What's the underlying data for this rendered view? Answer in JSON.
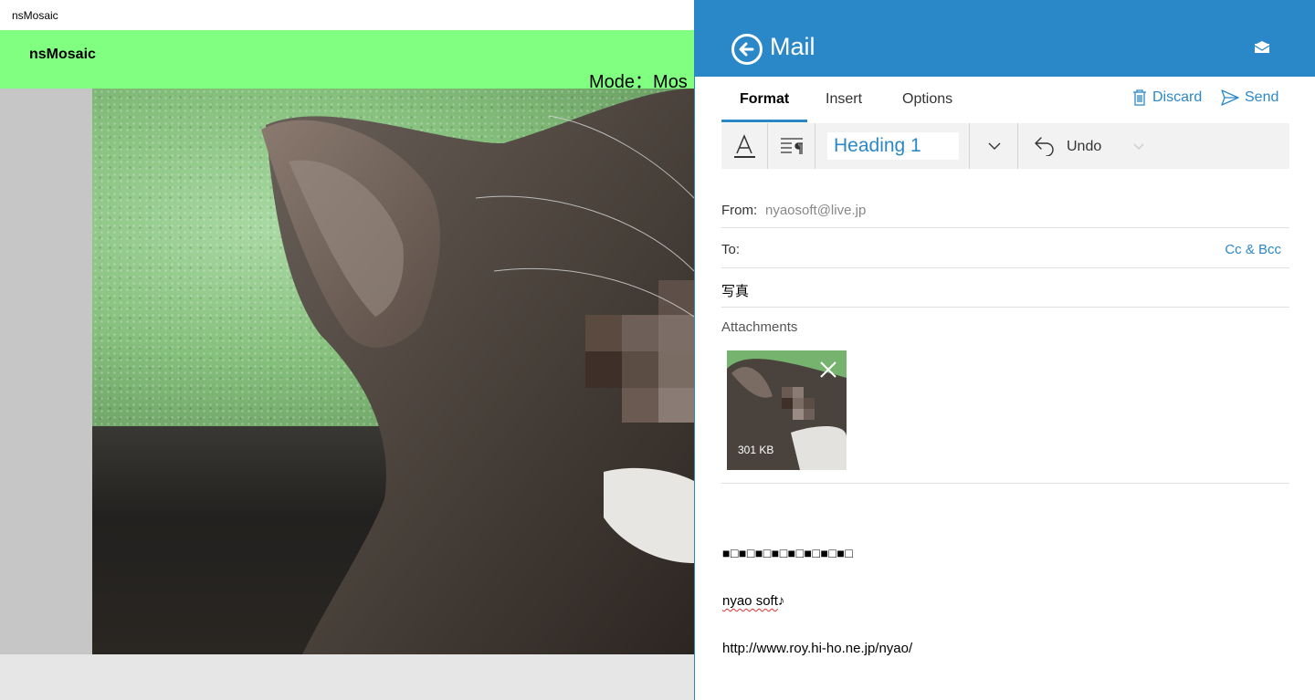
{
  "app": {
    "window_title": "nsMosaic",
    "header_title": "nsMosaic",
    "mode_text": "Mode：Mos",
    "colors": {
      "header_bg": "#80ff80",
      "side_col": "#c6c6c6"
    }
  },
  "mail": {
    "title": "Mail",
    "colors": {
      "accent": "#2b88c8"
    },
    "tabs": [
      {
        "label": "Format",
        "active": true
      },
      {
        "label": "Insert",
        "active": false
      },
      {
        "label": "Options",
        "active": false
      }
    ],
    "actions": {
      "discard_label": "Discard",
      "send_label": "Send"
    },
    "toolbar": {
      "font_icon": "font-color-icon",
      "paragraph_icon": "paragraph-icon",
      "style_value": "Heading 1",
      "undo_label": "Undo"
    },
    "from": {
      "label": "From:",
      "value": "nyaosoft@live.jp"
    },
    "to": {
      "label": "To:",
      "cc_bcc_label": "Cc & Bcc"
    },
    "subject": "写真",
    "attachments": {
      "label": "Attachments",
      "items": [
        {
          "size": "301 KB"
        }
      ]
    },
    "body": {
      "squares": "■□■□■□■□■□■□■□■□",
      "signature_name": "nyao soft",
      "signature_note": "♪",
      "url": "http://www.roy.hi-ho.ne.jp/nyao/"
    }
  }
}
